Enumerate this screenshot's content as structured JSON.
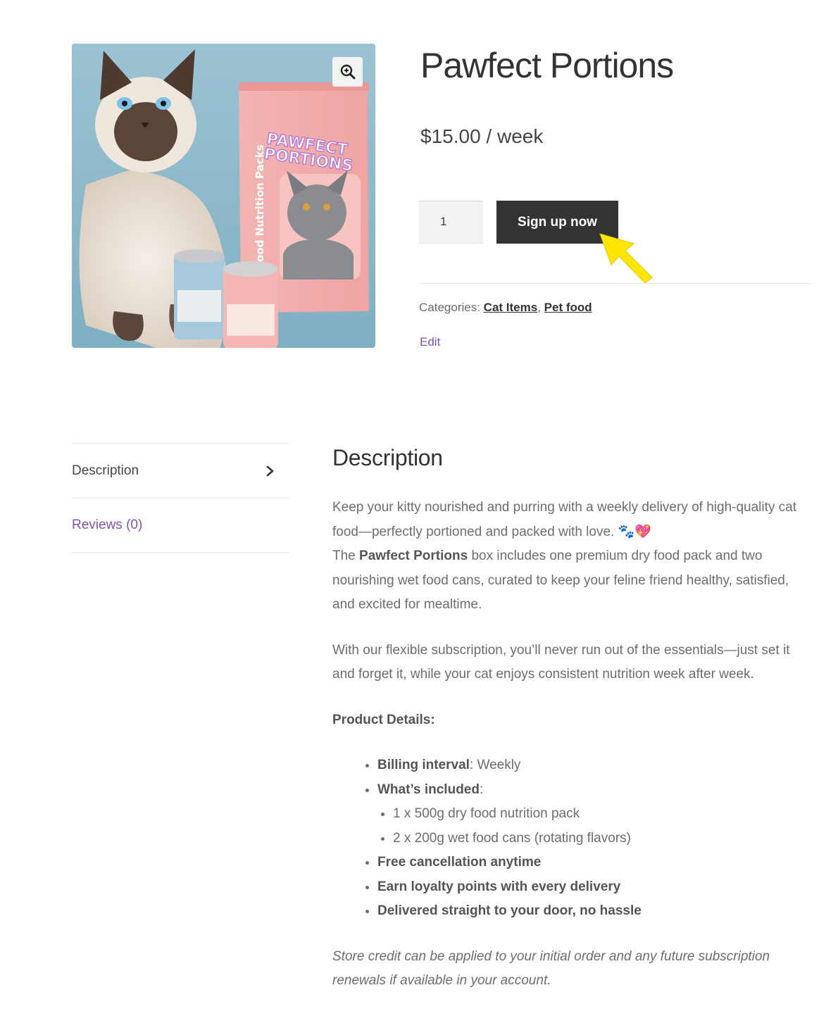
{
  "product": {
    "title": "Pawfect Portions",
    "price": "$15.00 / week",
    "quantity": "1",
    "signup_label": "Sign up now",
    "categories_label": "Categories:",
    "categories": [
      "Cat Items",
      "Pet food"
    ],
    "categories_sep": ",",
    "edit_label": "Edit",
    "image": {
      "pack_brand_line1": "PAWFECT",
      "pack_brand_line2": "PORTIONS",
      "pack_side_text": "ood Nutrition Packs"
    }
  },
  "tabs": [
    {
      "label": "Description",
      "active": true
    },
    {
      "label": "Reviews (0)",
      "active": false
    }
  ],
  "description": {
    "heading": "Description",
    "intro": "Keep your kitty nourished and purring with a weekly delivery of high-quality cat food—perfectly portioned and packed with love. 🐾💖",
    "box_prefix": "The ",
    "box_name": "Pawfect Portions",
    "box_suffix": " box includes one premium dry food pack and two nourishing wet food cans, curated to keep your feline friend healthy, satisfied, and excited for mealtime.",
    "flexible": "With our flexible subscription, you’ll never run out of the essentials—just set it and forget it, while your cat enjoys consistent nutrition week after week.",
    "details_heading": "Product Details:",
    "billing_label": "Billing interval",
    "billing_value": ": Weekly",
    "included_label": "What’s included",
    "included_colon": ":",
    "included_items": [
      "1 x 500g dry food nutrition pack",
      "2 x 200g wet food cans (rotating flavors)"
    ],
    "perks": [
      "Free cancellation anytime",
      "Earn loyalty points with every delivery",
      "Delivered straight to your door, no hassle"
    ],
    "store_credit": "Store credit can be applied to your initial order and any future subscription renewals if available in your account."
  },
  "colors": {
    "button_bg": "#333333",
    "link_purple": "#7f54b3",
    "arrow_yellow": "#ffe600",
    "image_bg": "#8fb8c8",
    "pack_pink": "#f0a9a8"
  },
  "icons": [
    "zoom-in-icon",
    "chevron-right-icon",
    "pointer-arrow-icon"
  ]
}
